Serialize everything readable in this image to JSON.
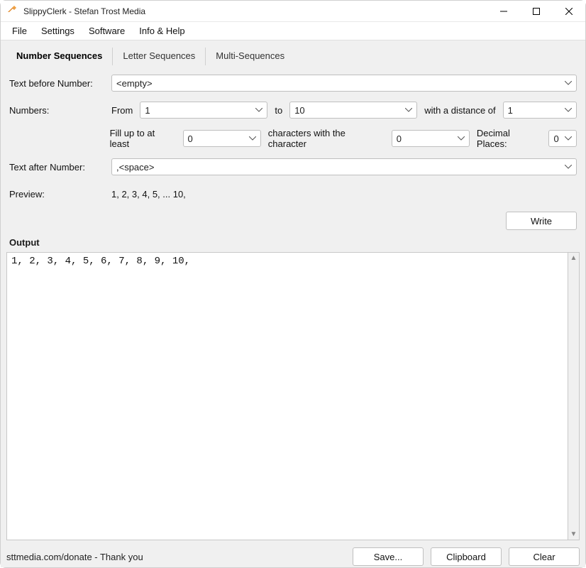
{
  "window": {
    "title": "SlippyClerk - Stefan Trost Media"
  },
  "menu": {
    "file": "File",
    "settings": "Settings",
    "software": "Software",
    "info_help": "Info & Help"
  },
  "tabs": {
    "number_sequences": "Number Sequences",
    "letter_sequences": "Letter Sequences",
    "multi_sequences": "Multi-Sequences"
  },
  "form": {
    "text_before_label": "Text before Number:",
    "text_before_value": "<empty>",
    "numbers_label": "Numbers:",
    "from_label": "From",
    "from_value": "1",
    "to_label": "to",
    "to_value": "10",
    "distance_label": "with a distance of",
    "distance_value": "1",
    "fill_label": "Fill up to at least",
    "fill_value": "0",
    "fill_chars_label": "characters with the character",
    "fill_char_value": "0",
    "decimal_label": "Decimal Places:",
    "decimal_value": "0",
    "text_after_label": "Text after Number:",
    "text_after_value": ",<space>",
    "preview_label": "Preview:",
    "preview_value": "1, 2, 3, 4, 5, ... 10,"
  },
  "buttons": {
    "write": "Write",
    "save": "Save...",
    "clipboard": "Clipboard",
    "clear": "Clear"
  },
  "output": {
    "header": "Output",
    "text": "1, 2, 3, 4, 5, 6, 7, 8, 9, 10, "
  },
  "status": {
    "text": "sttmedia.com/donate - Thank you"
  }
}
